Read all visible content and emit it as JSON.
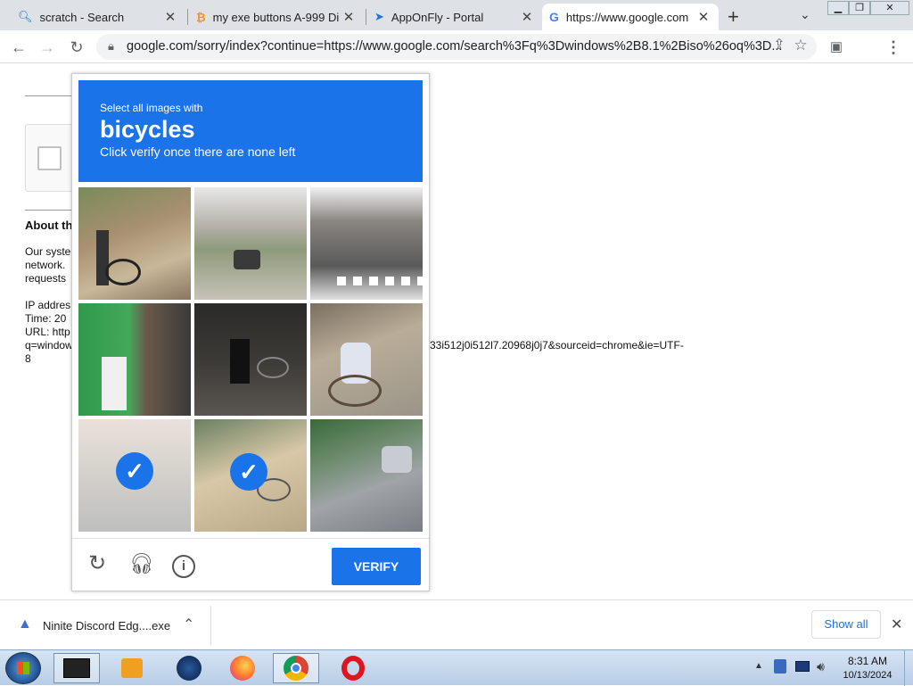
{
  "tabs": [
    {
      "title": "scratch - Search",
      "icon": "search-icon"
    },
    {
      "title": "my exe buttons A-999 Di",
      "icon": "bitcoin-icon"
    },
    {
      "title": "AppOnFly - Portal",
      "icon": "send-icon"
    },
    {
      "title": "https://www.google.com",
      "icon": "google-icon",
      "active": true
    }
  ],
  "toolbar": {
    "url": "google.com/sorry/index?continue=https://www.google.com/search%3Fq%3Dwindows%2B8.1%2Biso%26oq%3D..."
  },
  "page": {
    "about_heading": "About th",
    "line1": "Our syste",
    "line2": "network.",
    "line3": "requests",
    "ip_label": "IP addres",
    "time_label": "Time: 20",
    "url_label": "URL: http",
    "url_cont": "q=window",
    "url_tail": "33i512j0i512l7.20968j0j7&sourceid=chrome&ie=UTF-",
    "url_end": "8"
  },
  "captcha": {
    "instruction": "Select all images with",
    "target": "bicycles",
    "subtext": "Click verify once there are none left",
    "tiles_selected": [
      false,
      false,
      false,
      false,
      false,
      false,
      true,
      true,
      false
    ],
    "verify_label": "VERIFY"
  },
  "downloads": {
    "filename": "Ninite Discord Edg....exe",
    "show_all": "Show all"
  },
  "taskbar": {
    "time": "8:31 AM",
    "date": "10/13/2024"
  },
  "colors": {
    "accent": "#1a73e8",
    "tabstrip": "#dee1e6"
  }
}
